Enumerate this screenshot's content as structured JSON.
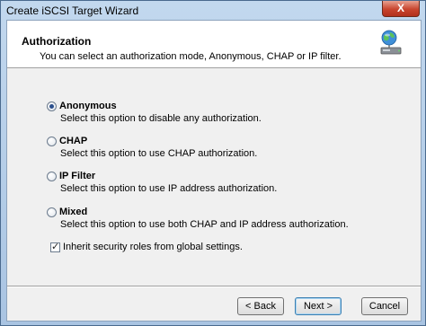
{
  "window": {
    "title": "Create iSCSI Target Wizard",
    "close_label": "X"
  },
  "header": {
    "title": "Authorization",
    "subtitle": "You can select an authorization mode, Anonymous, CHAP or IP filter.",
    "icon": "network-globe-icon"
  },
  "options": [
    {
      "label": "Anonymous",
      "description": "Select this option to disable any authorization.",
      "selected": true
    },
    {
      "label": "CHAP",
      "description": "Select this option to use CHAP authorization.",
      "selected": false
    },
    {
      "label": "IP Filter",
      "description": "Select this option to use IP address authorization.",
      "selected": false
    },
    {
      "label": "Mixed",
      "description": "Select this option to use both CHAP and IP address authorization.",
      "selected": false
    }
  ],
  "inherit": {
    "label": "Inherit security roles from global settings.",
    "checked": true
  },
  "buttons": {
    "back": "< Back",
    "next": "Next >",
    "cancel": "Cancel"
  },
  "colors": {
    "title_bar": "#b7cfe9",
    "close_button": "#c8452e",
    "radio_dot": "#2b4f8c"
  }
}
